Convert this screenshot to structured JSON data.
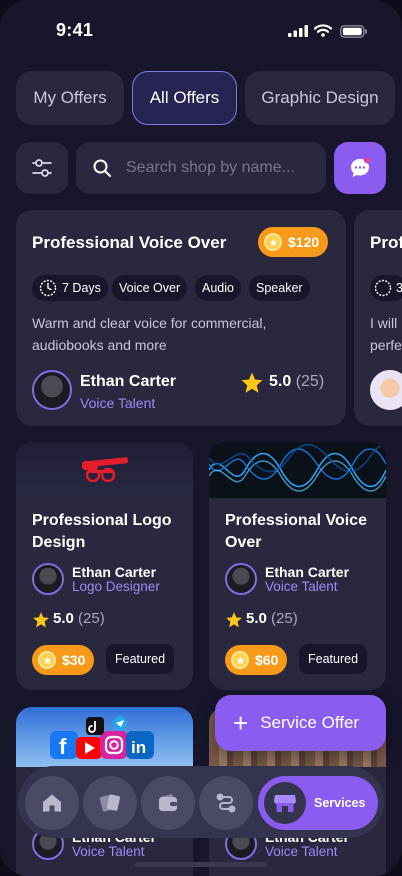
{
  "status_bar": {
    "time": "9:41"
  },
  "tabs": [
    "My Offers",
    "All Offers",
    "Graphic Design"
  ],
  "search": {
    "placeholder": "Search shop by name..."
  },
  "featured_card": {
    "title": "Professional Voice Over",
    "price": "$120",
    "tags": [
      "7 Days",
      "Voice Over",
      "Audio",
      "Speaker"
    ],
    "description": "Warm and clear voice for commercial, audiobooks and more",
    "seller": "Ethan Carter",
    "role": "Voice Talent",
    "rating": "5.0",
    "reviews": "(25)"
  },
  "peek_card": {
    "title": "Prof",
    "tag": "3",
    "desc_line1": "I will",
    "desc_line2": "perfe"
  },
  "grid_cards": [
    {
      "title": "Professional Logo Design",
      "seller": "Ethan Carter",
      "role": "Logo Designer",
      "rating": "5.0",
      "reviews": "(25)",
      "price": "$30",
      "badge": "Featured"
    },
    {
      "title": "Professional Voice Over",
      "seller": "Ethan Carter",
      "role": "Voice Talent",
      "rating": "5.0",
      "reviews": "(25)",
      "price": "$60",
      "badge": "Featured"
    }
  ],
  "bottom_cards": [
    {
      "seller": "Ethan Carter",
      "role": "Voice Talent"
    },
    {
      "seller": "Ethan Carter",
      "role": "Voice Talent"
    }
  ],
  "fab": {
    "label": "Service Offer"
  },
  "nav": {
    "items": [
      "home-icon",
      "cards-icon",
      "wallet-icon",
      "route-icon"
    ],
    "active_label": "Services",
    "active_icon": "storefront-icon"
  },
  "colors": {
    "accent": "#8a5cf0",
    "price": "#f79a1a",
    "background": "#17162b",
    "card": "#29283f",
    "role": "#9a8cf5"
  }
}
